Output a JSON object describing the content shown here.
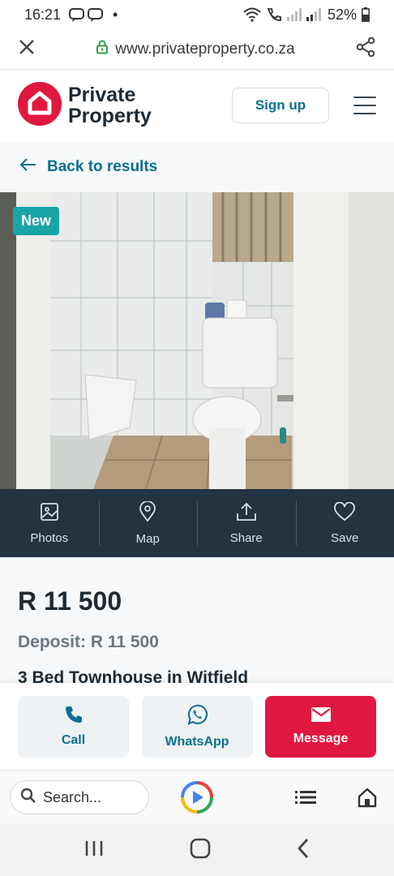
{
  "status_bar": {
    "time": "16:21",
    "battery": "52%"
  },
  "url_bar": {
    "url": "www.privateproperty.co.za"
  },
  "header": {
    "logo_line1": "Private",
    "logo_line2": "Property",
    "signup_label": "Sign up"
  },
  "back_link": {
    "label": "Back to results"
  },
  "photo": {
    "badge": "New"
  },
  "actions": [
    {
      "label": "Photos",
      "icon": "image-icon"
    },
    {
      "label": "Map",
      "icon": "map-pin-icon"
    },
    {
      "label": "Share",
      "icon": "share-icon"
    },
    {
      "label": "Save",
      "icon": "heart-icon"
    }
  ],
  "listing": {
    "price": "R 11 500",
    "deposit": "Deposit: R 11 500",
    "title": "3 Bed Townhouse in Witfield"
  },
  "contact": {
    "call_label": "Call",
    "whatsapp_label": "WhatsApp",
    "message_label": "Message"
  },
  "browser": {
    "search_placeholder": "Search..."
  },
  "colors": {
    "brand_red": "#e0173f",
    "accent_teal": "#0a6f8f",
    "dark_bar": "#233341",
    "badge_teal": "#1aa4a7"
  }
}
